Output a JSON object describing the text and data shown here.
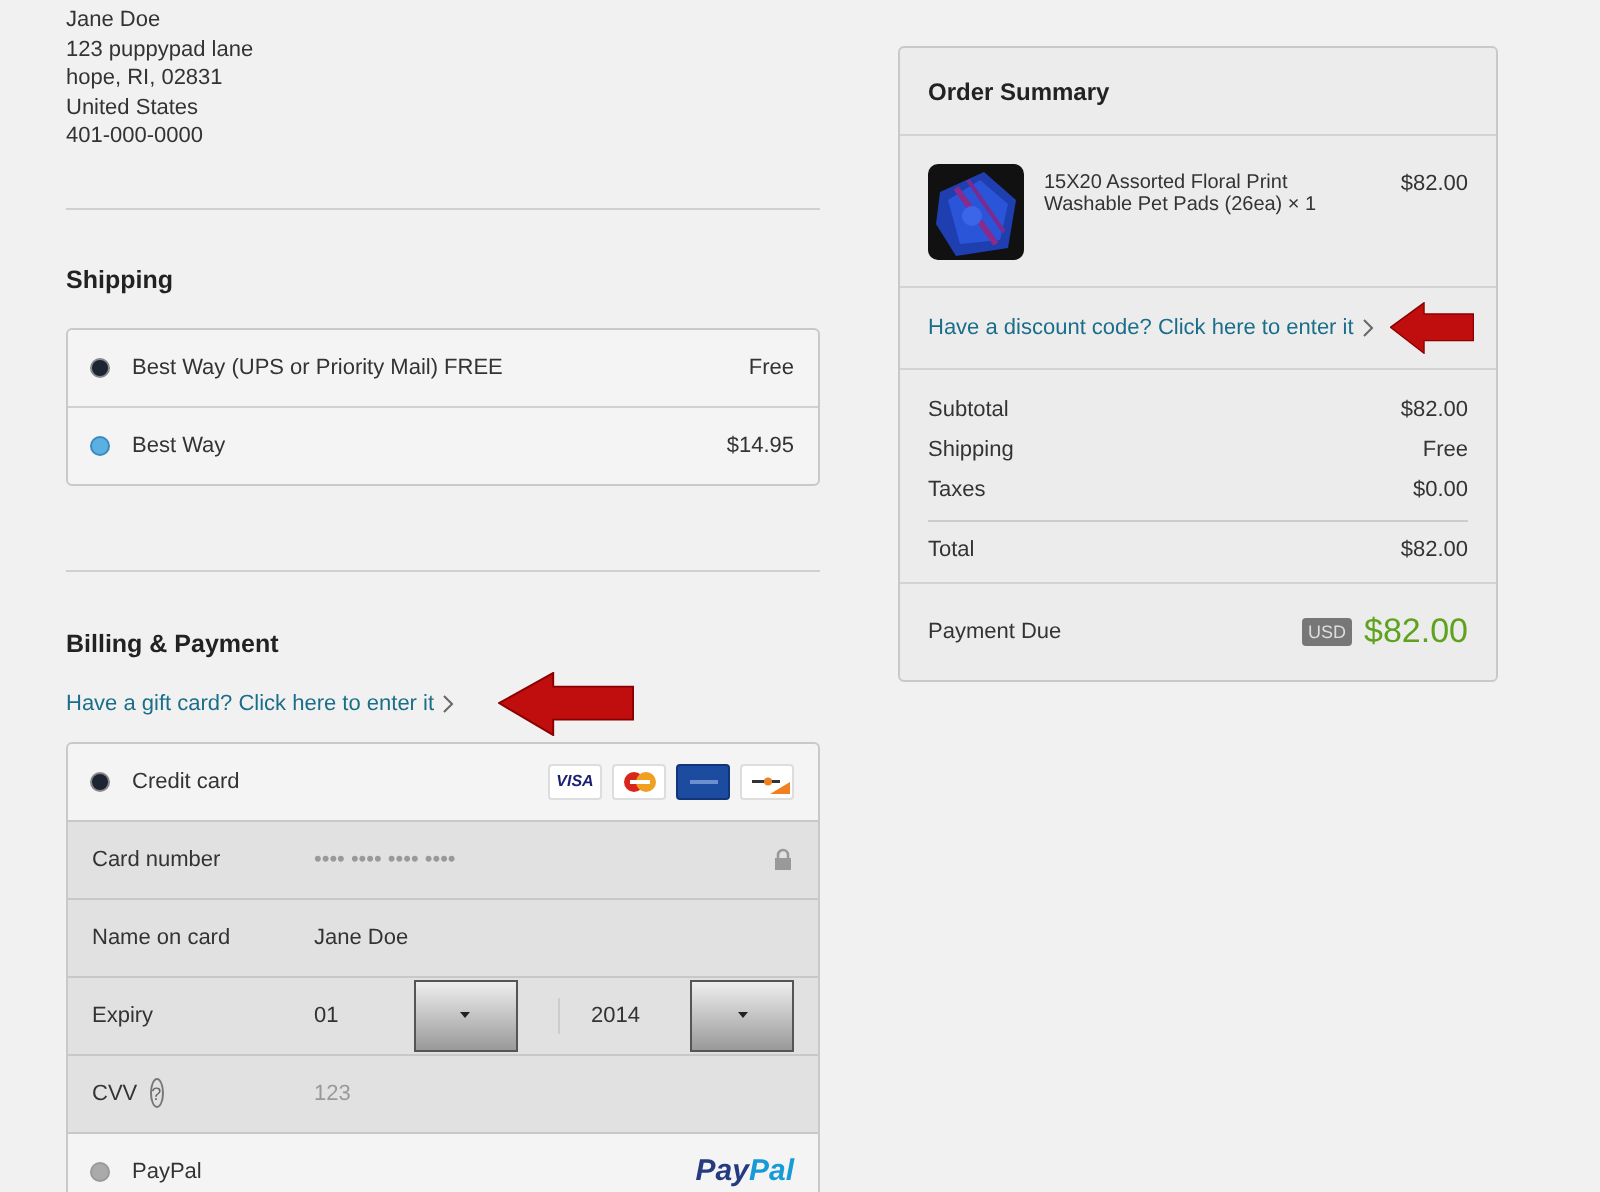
{
  "address": [
    "Jane Doe",
    "123 puppypad lane",
    "hope, RI, 02831",
    "United States",
    "401-000-0000"
  ],
  "shipping": {
    "title": "Shipping",
    "options": [
      {
        "label": "Best Way (UPS or Priority Mail) FREE",
        "price": "Free",
        "selected": true
      },
      {
        "label": "Best Way",
        "price": "$14.95",
        "selected": false
      }
    ]
  },
  "billing": {
    "title": "Billing & Payment",
    "gift_link": "Have a gift card? Click here to enter it",
    "methods": [
      {
        "kind": "card",
        "label": "Credit card",
        "selected": true,
        "logos": [
          {
            "kind": "visa",
            "text": "VISA"
          },
          {
            "kind": "mastercard"
          },
          {
            "kind": "amex"
          },
          {
            "kind": "discover"
          }
        ],
        "fields": [
          {
            "kind": "text",
            "label": "Card number",
            "placeholder": "•••• •••• •••• ••••",
            "lock": true
          },
          {
            "kind": "text",
            "label": "Name on card",
            "value": "Jane Doe"
          },
          {
            "kind": "selects",
            "label": "Expiry",
            "values": [
              "01",
              "2014"
            ]
          },
          {
            "kind": "text",
            "label": "CVV",
            "placeholder": "123",
            "help": "?"
          }
        ]
      },
      {
        "kind": "paypal",
        "label": "PayPal",
        "selected": false,
        "logo": [
          "Pay",
          "Pal"
        ]
      }
    ]
  },
  "summary": {
    "title": "Order Summary",
    "items": [
      {
        "name": "15X20 Assorted Floral Print Washable Pet Pads (26ea) × 1",
        "price": "$82.00"
      }
    ],
    "discount_link": "Have a discount code? Click here to enter it",
    "lines": [
      {
        "label": "Subtotal",
        "value": "$82.00"
      },
      {
        "label": "Shipping",
        "value": "Free"
      },
      {
        "label": "Taxes",
        "value": "$0.00"
      }
    ],
    "total": {
      "label": "Total",
      "value": "$82.00"
    },
    "due": {
      "label": "Payment Due",
      "currency": "USD",
      "value": "$82.00"
    }
  }
}
